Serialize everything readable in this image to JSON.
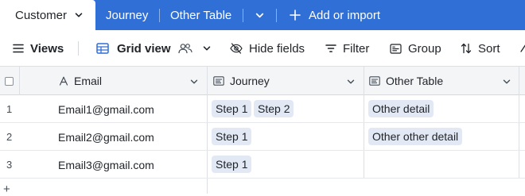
{
  "tabs": {
    "active": "Customer",
    "items": [
      "Journey",
      "Other Table"
    ],
    "add_import": "Add or import"
  },
  "toolbar": {
    "views": "Views",
    "grid_view": "Grid view",
    "hide_fields": "Hide fields",
    "filter": "Filter",
    "group": "Group",
    "sort": "Sort"
  },
  "grid": {
    "columns": [
      "Email",
      "Journey",
      "Other Table"
    ],
    "rows": [
      {
        "num": "1",
        "email": "Email1@gmail.com",
        "journey": [
          "Step 1",
          "Step 2"
        ],
        "other": [
          "Other detail"
        ]
      },
      {
        "num": "2",
        "email": "Email2@gmail.com",
        "journey": [
          "Step 1"
        ],
        "other": [
          "Other other detail"
        ]
      },
      {
        "num": "3",
        "email": "Email3@gmail.com",
        "journey": [
          "Step 1"
        ],
        "other": []
      }
    ],
    "add_row": "+"
  },
  "colors": {
    "accent": "#2f6fd6",
    "chip_bg": "#e3e9f4",
    "header_bg": "#f4f5f7"
  }
}
